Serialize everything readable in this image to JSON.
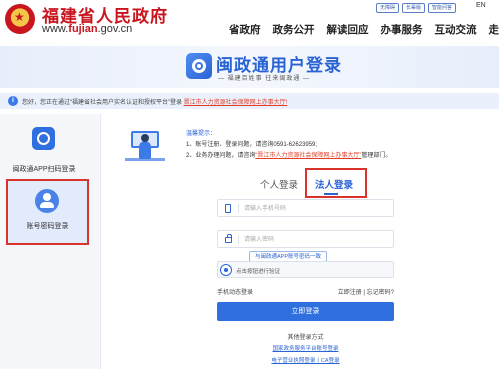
{
  "header": {
    "site_title": "福建省人民政府",
    "url_prefix": "www.",
    "url_brand": "fujian",
    "url_suffix": ".gov.cn",
    "top_links": [
      "无障碍",
      "长辈版",
      "智能问答"
    ],
    "lang": "EN",
    "nav": [
      "省政府",
      "政务公开",
      "解读回应",
      "办事服务",
      "互动交流",
      "走进"
    ]
  },
  "banner": {
    "title": "闽政通用户登录",
    "subtitle": "— 福建百姓事  往来闽政通 —"
  },
  "notice": {
    "text": "您好，您正在通过“福建省社会用户实名认证和授权平台”登录",
    "link": "晋江市人力资源社会保障网上办事大厅!"
  },
  "left_panel": {
    "options": [
      {
        "label": "闽政通APP扫码登录",
        "icon": "app-logo-icon",
        "selected": false
      },
      {
        "label": "账号密码登录",
        "icon": "user-icon",
        "selected": true
      }
    ]
  },
  "tips": {
    "title": "温馨提示：",
    "line1": "1、账号注册、登录问题，请咨询0591-62623959;",
    "line2_prefix": "2、业务办理问题，请咨询",
    "line2_link": "“晋江市人力资源社会保障网上办事大厅”",
    "line2_suffix": "管理部门。"
  },
  "tabs": {
    "personal": "个人登录",
    "legal": "法人登录",
    "active": "legal"
  },
  "form": {
    "phone_placeholder": "请输入手机号码",
    "password_placeholder": "请输入密码",
    "tooltip": "与闽政通APP账号密码一致",
    "captcha_text": "点击按钮进行验证",
    "sms_login": "手机动态登录",
    "register": "立即注册",
    "forgot": "忘记密码?",
    "login_button": "立即登录",
    "other_title": "其他登录方式",
    "other_link1": "国家政务服务平台账号登录",
    "other_link2": "电子营业执照登录丨CA登录"
  },
  "colors": {
    "brand_red": "#c9151e",
    "primary_blue": "#2f6fe0",
    "highlight_border": "#d9342b"
  }
}
